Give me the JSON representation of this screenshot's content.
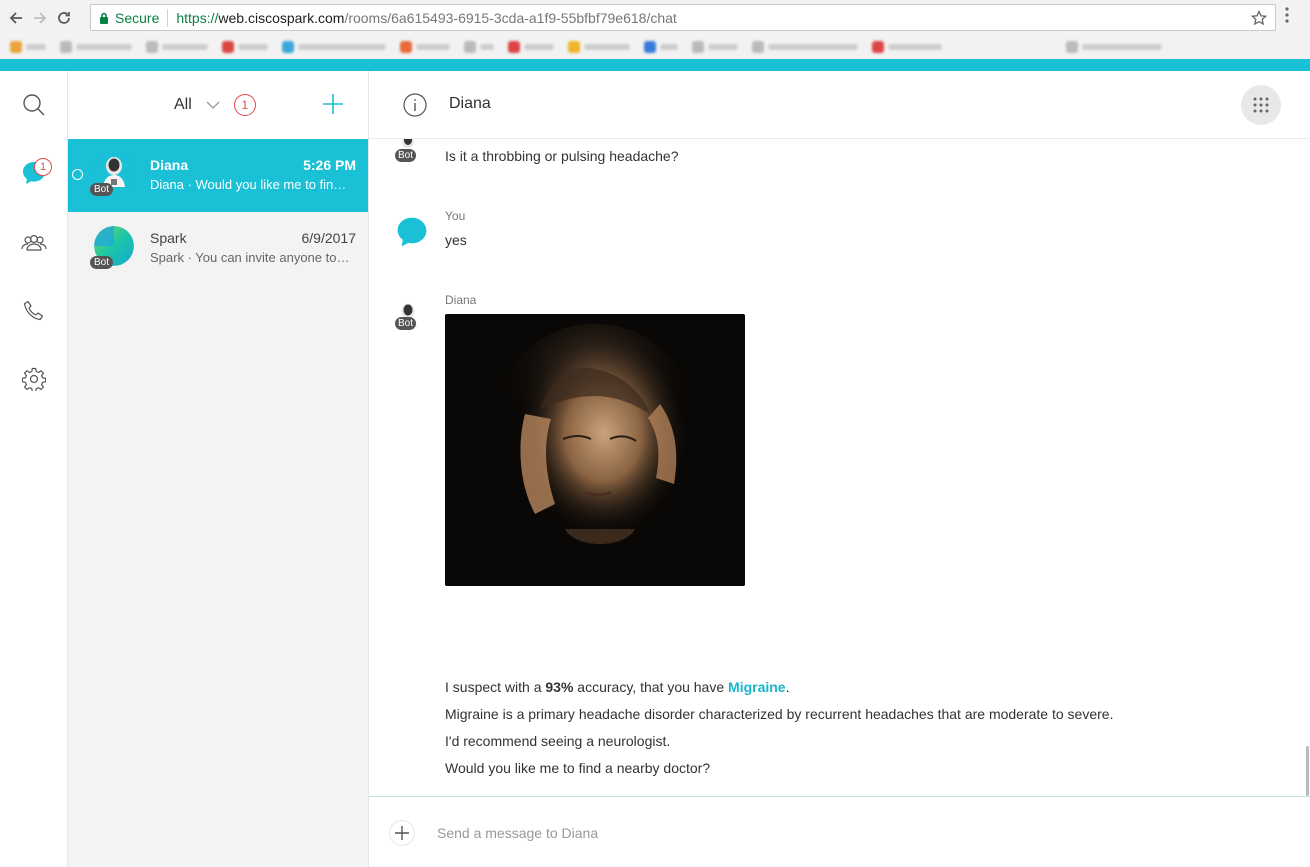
{
  "browser": {
    "secure_label": "Secure",
    "url_scheme": "https://",
    "url_host": "web.ciscospark.com",
    "url_path": "/rooms/6a615493-6915-3cda-a1f9-55bfbf79e618/chat"
  },
  "colors": {
    "accent": "#19c0d6",
    "badge": "#e34a4a"
  },
  "rail": {
    "spaces_badge": "1"
  },
  "roomlist": {
    "filter_label": "All",
    "unread_badge": "1",
    "rooms": [
      {
        "name": "Diana",
        "time": "5:26 PM",
        "preview": "Diana · Would you like me to find a nearby doctor?",
        "tag": "Bot"
      },
      {
        "name": "Spark",
        "time": "6/9/2017",
        "preview": "Spark · You can invite anyone to a space",
        "tag": "Bot"
      }
    ]
  },
  "conversation": {
    "title": "Diana",
    "messages": {
      "m1": {
        "tag": "Bot",
        "text": "Is it a throbbing or pulsing headache?"
      },
      "m2": {
        "sender": "You",
        "text": "yes"
      },
      "m3": {
        "sender": "Diana",
        "tag": "Bot",
        "line1_pre": "I suspect with a ",
        "line1_pct": "93%",
        "line1_mid": " accuracy, that you have ",
        "line1_cond": "Migraine",
        "line1_end": ".",
        "line2": "Migraine is a primary headache disorder characterized by recurrent headaches that are moderate to severe.",
        "line3": "I'd recommend seeing a neurologist.",
        "line4": "Would you like me to find a nearby doctor?"
      }
    },
    "composer_placeholder": "Send a message to Diana"
  }
}
